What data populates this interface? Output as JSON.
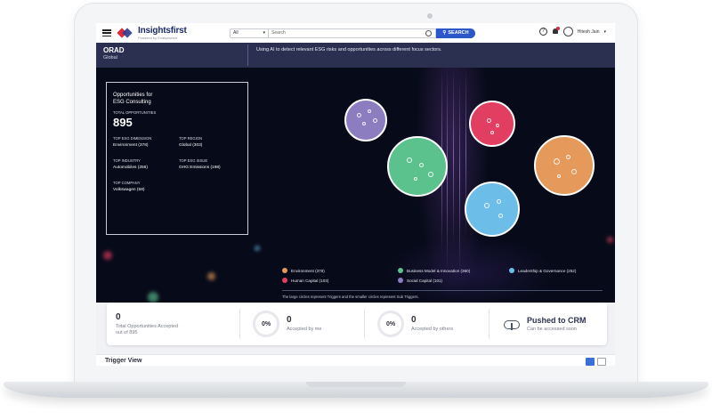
{
  "header": {
    "logo_name": "Insightsfirst",
    "logo_sub": "Powered by Evalueserve",
    "search_scope": "All",
    "search_placeholder": "Search",
    "search_button": "SEARCH",
    "user_name": "Hitesh Jain"
  },
  "title_bar": {
    "company": "ORAD",
    "region": "Global",
    "tagline": "Using AI to detect relevant ESG risks and opportunities across different focus sectors."
  },
  "opportunities": {
    "title_line1": "Opportunities for",
    "title_line2": "ESG Consulting",
    "total_label": "TOTAL OPPORTUNITIES",
    "total_value": "895",
    "stats": [
      {
        "label": "TOP ESG DIMENSION",
        "value": "Environment (378)"
      },
      {
        "label": "TOP REGION",
        "value": "Global (303)"
      },
      {
        "label": "TOP INDUSTRY",
        "value": "Automobiles (256)"
      },
      {
        "label": "TOP ESG ISSUE",
        "value": "GHG Emissions (198)"
      }
    ],
    "top_company_label": "TOP COMPANY",
    "top_company_value": "Volkswagen (58)"
  },
  "bubble_colors": {
    "environment": "#e59a5b",
    "human_capital": "#e23e62",
    "business_model": "#5bc28e",
    "social_capital": "#8c7cc0",
    "leadership": "#6cbde8"
  },
  "legend": {
    "items": [
      {
        "label": "Environment (378)",
        "color": "#e59a5b"
      },
      {
        "label": "Business Model & Innovation (360)",
        "color": "#5bc28e"
      },
      {
        "label": "Leadership & Governance (252)",
        "color": "#6cbde8"
      },
      {
        "label": "Human Capital (103)",
        "color": "#e23e62"
      },
      {
        "label": "Social Capital (101)",
        "color": "#8c7cc0"
      }
    ],
    "note": "The large circles represent Triggers and the smaller circles represent Sub Triggers."
  },
  "summary": {
    "accepted_total": "0",
    "accepted_total_label_1": "Total Opportunities Accepted",
    "accepted_total_label_2": "out of 895",
    "by_me_pct": "0%",
    "by_me_count": "0",
    "by_me_label": "Accepted by me",
    "by_others_pct": "0%",
    "by_others_count": "0",
    "by_others_label": "Accepted by others",
    "crm_title": "Pushed to CRM",
    "crm_sub": "Can be accessed soon"
  },
  "trigger_section": {
    "label": "Trigger View"
  }
}
